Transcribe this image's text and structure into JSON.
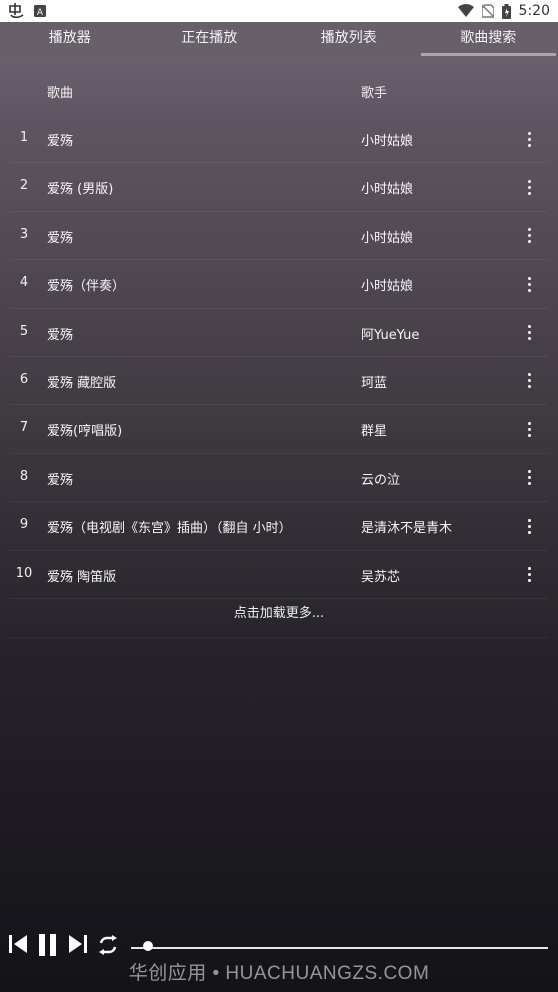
{
  "status_bar": {
    "time": "5:20",
    "left_icons": [
      "app-logo-icon",
      "a-badge-icon"
    ],
    "right_icons": [
      "wifi-icon",
      "no-sim-icon",
      "battery-icon"
    ]
  },
  "tabs": [
    {
      "label": "播放器",
      "active": false
    },
    {
      "label": "正在播放",
      "active": false
    },
    {
      "label": "播放列表",
      "active": false
    },
    {
      "label": "歌曲搜索",
      "active": true
    }
  ],
  "list_header": {
    "song": "歌曲",
    "artist": "歌手"
  },
  "songs": [
    {
      "index": "1",
      "title": "爱殇",
      "artist": "小时姑娘"
    },
    {
      "index": "2",
      "title": "爱殇 (男版)",
      "artist": "小时姑娘"
    },
    {
      "index": "3",
      "title": "爱殇",
      "artist": "小时姑娘"
    },
    {
      "index": "4",
      "title": "爱殇（伴奏）",
      "artist": "小时姑娘"
    },
    {
      "index": "5",
      "title": "爱殇",
      "artist": "阿YueYue"
    },
    {
      "index": "6",
      "title": "爱殇 藏腔版",
      "artist": "珂蓝"
    },
    {
      "index": "7",
      "title": "爱殇(哼唱版)",
      "artist": "群星"
    },
    {
      "index": "8",
      "title": "爱殇",
      "artist": "云の泣"
    },
    {
      "index": "9",
      "title": "爱殇（电视剧《东宫》插曲）（翻自 小时）",
      "artist": "是清沐不是青木"
    },
    {
      "index": "10",
      "title": "爱殇 陶笛版",
      "artist": "吴苏芯"
    }
  ],
  "load_more": "点击加载更多...",
  "player": {
    "controls": [
      "previous-icon",
      "pause-icon",
      "next-icon",
      "repeat-icon"
    ],
    "progress": 0.04
  },
  "watermark": "华创应用 • HUACHUANGZS.COM",
  "colors": {
    "tab_bar": "#67606a",
    "tab_indicator": "#a9a5ab",
    "text": "#f5f5f5"
  }
}
